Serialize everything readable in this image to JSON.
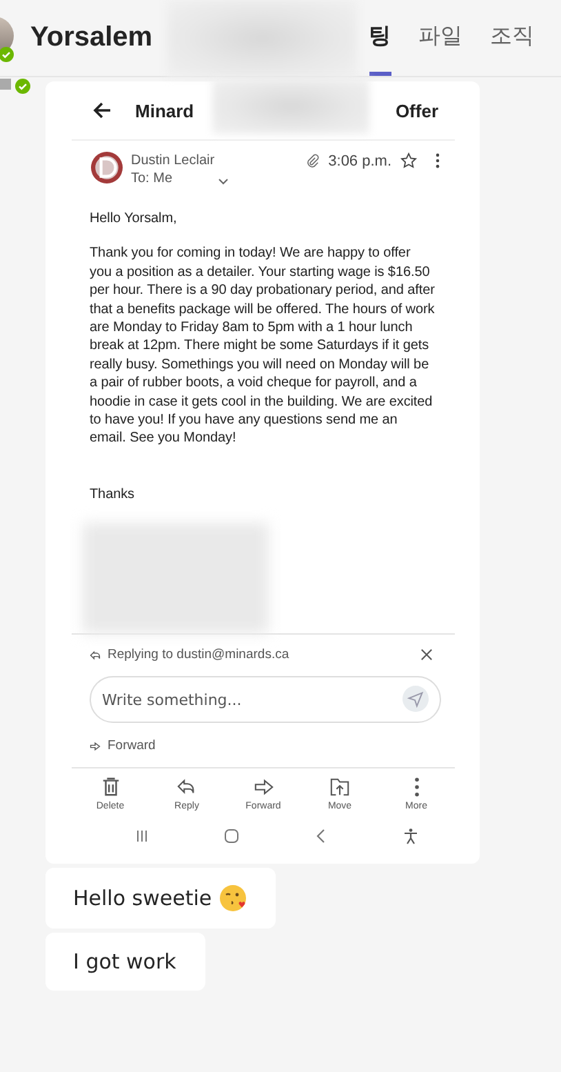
{
  "header": {
    "name": "Yorsalem",
    "tabs": [
      {
        "label": "팅",
        "selected": true
      },
      {
        "label": "파일",
        "selected": false
      },
      {
        "label": "조직",
        "selected": false
      }
    ]
  },
  "email": {
    "subject_start": "Minard",
    "subject_end": "Offer",
    "sender": "Dustin Leclair",
    "recipient": "To: Me",
    "time": "3:06 p.m.",
    "greeting": "Hello Yorsalm,",
    "body": "Thank you for coming in today! We are happy to offer you a position as a detailer. Your starting wage is $16.50 per hour. There is a 90 day probationary period, and after that a benefits package will be offered. The hours of work are Monday to Friday 8am to 5pm with a 1 hour lunch break at 12pm. There might be some Saturdays if it gets really busy. Somethings you will need on Monday will be a pair of rubber boots, a void cheque for payroll, and a hoodie in case it gets cool in the building. We are excited to have you! If you have any questions send me an email. See you Monday!",
    "closing": "Thanks",
    "replying_to": "Replying to dustin@minards.ca",
    "reply_placeholder": "Write something...",
    "forward": "Forward",
    "actions": [
      {
        "kind": "delete",
        "label": "Delete"
      },
      {
        "kind": "reply",
        "label": "Reply"
      },
      {
        "kind": "forward",
        "label": "Forward"
      },
      {
        "kind": "move",
        "label": "Move"
      },
      {
        "kind": "more",
        "label": "More"
      }
    ]
  },
  "messages": [
    {
      "text": "Hello sweetie",
      "emoji": true
    },
    {
      "text": "I got work",
      "emoji": false
    }
  ]
}
